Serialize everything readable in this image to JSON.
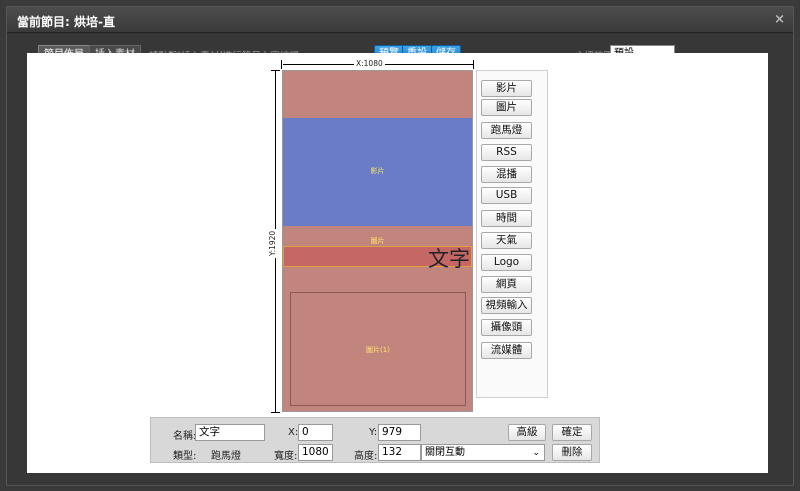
{
  "window": {
    "title": "當前節目: 烘培-直",
    "close_glyph": "×"
  },
  "toolbar": {
    "tabs": [
      {
        "label": "節目佈局",
        "active": true
      },
      {
        "label": "插入素材",
        "active": false
      }
    ],
    "hint": "請點擊[插入素材]進行節目內容編輯。",
    "preview_label": "預覽",
    "reset_label": "重設",
    "save_label": "儲存",
    "mode_label": "主播放區",
    "mode_value": "預設"
  },
  "canvas": {
    "width_label": "X:1080",
    "height_label": "Y:1920",
    "regions": [
      {
        "label": "",
        "color": "#c1857d"
      },
      {
        "label": "影片",
        "color": "#6a7cc5"
      },
      {
        "label": "圖片",
        "color": "#c1857d"
      },
      {
        "label": "",
        "color": "#c56865"
      },
      {
        "label": "圖片(1)",
        "color": "#c1857d"
      }
    ],
    "overlay_text": "文字"
  },
  "side_buttons": [
    "影片",
    "圖片",
    "跑馬燈",
    "RSS",
    "混播",
    "USB",
    "時間",
    "天氣",
    "Logo",
    "網頁",
    "視頻輸入",
    "攝像頭",
    "流媒體"
  ],
  "props": {
    "name_label": "名稱:",
    "name_value": "文字",
    "x_label": "X:",
    "x_value": "0",
    "y_label": "Y:",
    "y_value": "979",
    "type_label": "類型:",
    "type_value": "跑馬燈",
    "width_label": "寬度:",
    "width_value": "1080",
    "height_label": "高度:",
    "height_value": "132",
    "interaction_value": "關閉互動",
    "advanced_label": "高級",
    "confirm_label": "確定",
    "delete_label": "刪除"
  },
  "colors": {
    "accent_button": "#1b7bc7",
    "region_pink": "#c1857d",
    "region_blue": "#6a7cc5",
    "label_yellow": "#ffe36a"
  }
}
